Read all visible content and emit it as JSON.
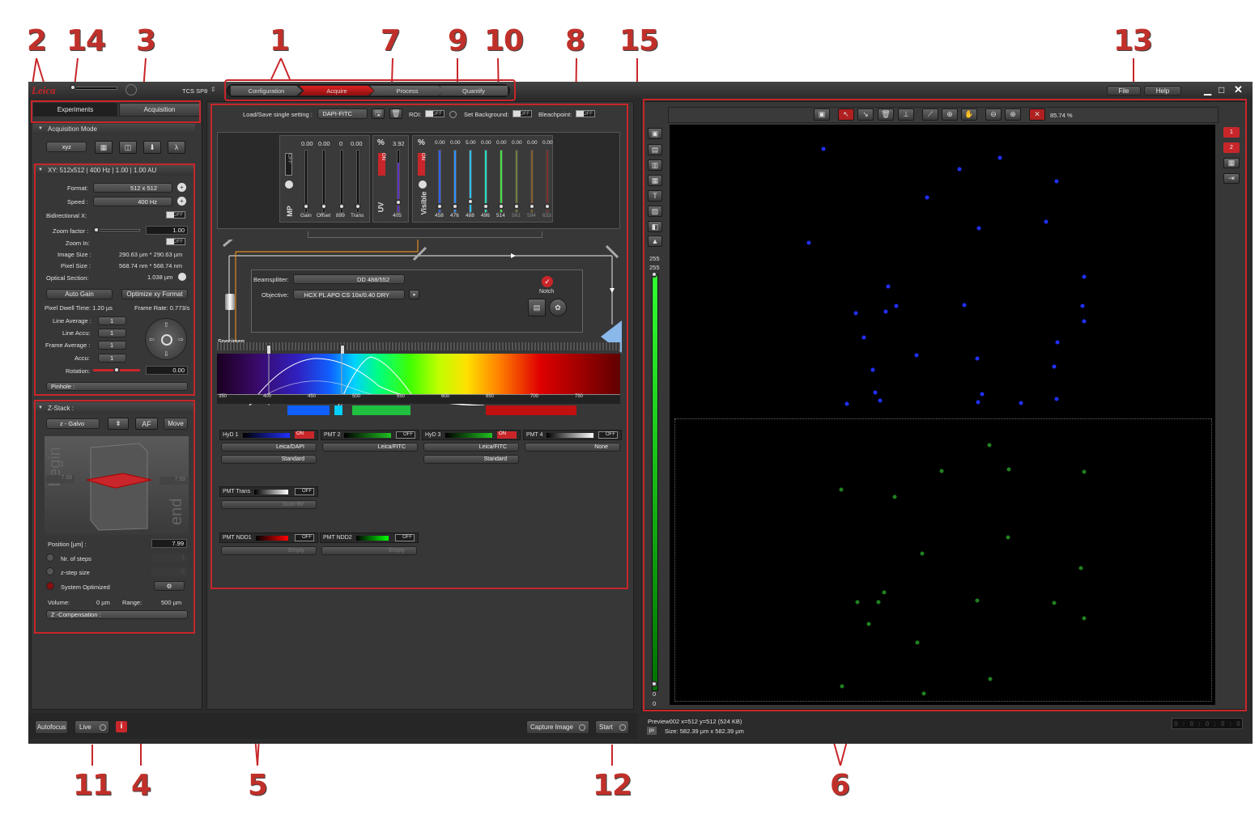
{
  "callouts": [
    "1",
    "2",
    "3",
    "4",
    "5",
    "6",
    "7",
    "8",
    "9",
    "10",
    "11",
    "12",
    "13",
    "14",
    "15"
  ],
  "top": {
    "system": "TCS SP8",
    "workflow_tabs": [
      "Configuration",
      "Acquire",
      "Process",
      "Quantify"
    ],
    "menu": [
      "File",
      "Help"
    ]
  },
  "left_tabs": [
    "Experiments",
    "Acquisition"
  ],
  "acq_mode": {
    "title": "Acquisition Mode",
    "mode": "xyz"
  },
  "xy": {
    "title": "XY: 512x512 | 400 Hz | 1.00 | 1.00 AU",
    "format_label": "Format:",
    "format": "512 x 512",
    "speed_label": "Speed :",
    "speed": "400 Hz",
    "bidir_label": "Bidirectional X:",
    "zoom_label": "Zoom factor :",
    "zoom": "1.00",
    "zoomin_label": "Zoom In:",
    "imgsize_label": "Image Size :",
    "imgsize": "290.63 µm * 290.63 µm",
    "pixsize_label": "Pixel Size :",
    "pixsize": "568.74 nm * 568.74 nm",
    "optsec_label": "Optical Section:",
    "optsec": "1.038 µm",
    "autogain": "Auto Gain",
    "optimize": "Optimize xy Format",
    "dwell": "Pixel Dwell Time: 1.20 µs",
    "framerate": "Frame Rate: 0.773/s",
    "lineavg_label": "Line Average :",
    "lineavg": "1",
    "lineaccu_label": "Line Accu:",
    "lineaccu": "1",
    "frameavg_label": "Frame Average :",
    "frameavg": "1",
    "accu_label": "Accu:",
    "accu": "1",
    "rotation_label": "Rotation:",
    "rotation": "0.00",
    "pinhole": "Pinhole :"
  },
  "zstack": {
    "title": "Z-Stack :",
    "drive": "z - Galvo",
    "move": "Move",
    "begin": "begin",
    "end": "end",
    "begin_val": "7.99",
    "end_val": "7.99",
    "position_label": "Position [µm] :",
    "position": "7.99",
    "steps_label": "Nr. of steps",
    "steps": "1",
    "stepsize_label": "z-step size",
    "stepsize": "0",
    "sysopt_label": "System Optimized",
    "volume": "Volume:",
    "volume_val": "0 µm",
    "range": "Range:",
    "range_val": "500 µm",
    "zcomp": "Z -Compensation :"
  },
  "bottom_left": {
    "autofocus": "Autofocus",
    "live": "Live",
    "capture": "Capture Image",
    "start": "Start"
  },
  "center": {
    "load_label": "Load/Save single setting :",
    "setting": "DAPI-FITC",
    "roi": "ROI:",
    "setbg": "Set Background:",
    "bleach": "Bleachpoint:",
    "mp_vals": [
      "0.00",
      "0.00",
      "0",
      "0.00"
    ],
    "mp_labels": [
      "Gain",
      "Offset",
      "899",
      "Trans"
    ],
    "mp": "MP",
    "uv_pct": "3.92",
    "uv_line": "405",
    "uv": "UV",
    "vis_vals": [
      "0.00",
      "0.00",
      "5.00",
      "0.00",
      "0.00",
      "0.00",
      "0.00",
      "0.00"
    ],
    "vis_lines": [
      "458",
      "476",
      "488",
      "496",
      "514",
      "561",
      "594",
      "633"
    ],
    "visible": "Visible",
    "pct": "%",
    "on": "ON",
    "off": "OFF",
    "bs_label": "Beamsplitter:",
    "bs": "DD 488/552",
    "obj_label": "Objective:",
    "obj": "HCX PL APO CS   10x/0.40 DRY",
    "notch": "Notch",
    "specimen": "Specimen",
    "spectrum_ticks": [
      "350",
      "400",
      "450",
      "500",
      "550",
      "600",
      "650",
      "700",
      "750"
    ],
    "detectors": [
      {
        "name": "HyD 1",
        "state": "ON",
        "dye": "Leica/DAPI",
        "mode": "Standard",
        "color": "#2030ff"
      },
      {
        "name": "PMT 2",
        "state": "OFF",
        "dye": "Leica/FITC",
        "mode": "",
        "color": "#20c020"
      },
      {
        "name": "HyD 3",
        "state": "ON",
        "dye": "Leica/FITC",
        "mode": "Standard",
        "color": "#20c020"
      },
      {
        "name": "PMT 4",
        "state": "OFF",
        "dye": "None",
        "mode": "",
        "color": "#ffffff"
      }
    ],
    "pmt_trans": {
      "name": "PMT Trans",
      "dye": "Scan-BF"
    },
    "ndd1": {
      "name": "PMT NDD1",
      "dye": "Empty"
    },
    "ndd2": {
      "name": "PMT NDD2",
      "dye": "Empty"
    }
  },
  "viewer": {
    "zoom": "85.74 %",
    "lut_top": "255",
    "lut_top2": "255",
    "lut_bot": "0",
    "lut_bot2": "0",
    "channels": [
      "1",
      "2"
    ],
    "status1": "Preview002 x=512 y=512  (524 KB)",
    "status2": "Size: 582.39 µm x 582.39 µm",
    "px": "px",
    "counter": "0 : 0 : 0 : 0 : 0"
  },
  "colors": {
    "accent": "#c8262a",
    "dapi": "#2030ff",
    "fitc": "#20c020"
  }
}
